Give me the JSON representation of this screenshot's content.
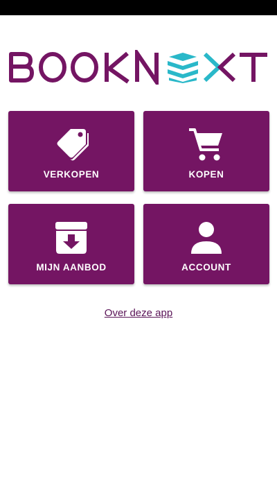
{
  "app": {
    "logo_text": "BOOKNEXT",
    "colors": {
      "brand_purple": "#741563",
      "accent_teal": "#2ab8c9",
      "background": "#ffffff"
    }
  },
  "tiles": [
    {
      "id": "sell",
      "label": "VERKOPEN",
      "icon": "tags-icon"
    },
    {
      "id": "buy",
      "label": "KOPEN",
      "icon": "shopping-cart-icon"
    },
    {
      "id": "offer",
      "label": "MIJN AANBOD",
      "icon": "archive-download-icon"
    },
    {
      "id": "account",
      "label": "ACCOUNT",
      "icon": "user-icon"
    }
  ],
  "footer": {
    "about_link": "Over deze app"
  }
}
